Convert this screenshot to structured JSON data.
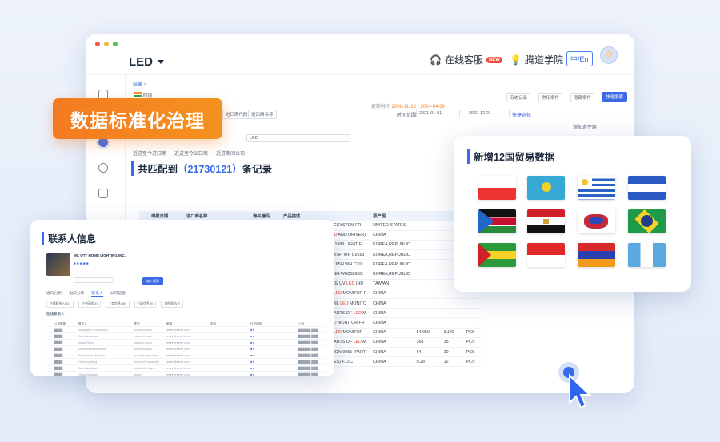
{
  "app": {
    "title": "LED",
    "support": "在线客服",
    "support_badge": "NEW",
    "academy": "腾道学院",
    "lang": "中/En"
  },
  "tabs": {
    "current": "结果",
    "close": "×",
    "country": "印度"
  },
  "filters": {
    "date_label": "时间范围",
    "date_start": "2021-01-01",
    "date_end": "2022-12-21",
    "quick": "快捷选择",
    "update_label": "更新时间",
    "update_from": "2006-11-12",
    "update_to": "2024-04-30",
    "history": "历史记录",
    "common": "常用条件",
    "hide": "隐藏条件",
    "search_btn": "快速搜索",
    "add_cond": "添加条件组",
    "keyword": "LED",
    "import1": "进口商代码",
    "import2": "进口商名称",
    "opt1": "近进至今进口商",
    "opt2": "近进至今出口商",
    "opt3": "近进期间公司"
  },
  "result": {
    "prefix": "共匹配到",
    "count": "（21730121）",
    "suffix": "条记录"
  },
  "table": {
    "headers": [
      "",
      "申报日期",
      "进口商名称",
      "",
      "海关编码",
      "产品描述",
      "原产国",
      "",
      "",
      ""
    ],
    "rows": [
      [
        "2022-12-21",
        "",
        "",
        "85437099",
        "36990754 LED-UV-CURINGSYSTEM FR",
        "UNITED STATES",
        "",
        "",
        ""
      ],
      [
        "2022-12-21",
        "",
        "",
        "94054900",
        "HANGING LIGHT (W/O LED AND DRIVER)",
        "CHINA",
        "",
        "",
        ""
      ],
      [
        "2022-12-21",
        "",
        "",
        "85414090",
        "LED SW-S3752-PW-T (3621989 LIGHT E",
        "KOREA,REPUBLIC",
        "",
        "",
        ""
      ],
      [
        "2022-12-21",
        "",
        "",
        "85414090",
        "LED SH-WHD0204-PL BLUISH WH C9163",
        "KOREA,REPUBLIC",
        "",
        "",
        ""
      ],
      [
        "2022-12-21",
        "",
        "",
        "85414090",
        "LED WS-L3612-BH-HC BLUISH WH C101",
        "KOREA,REPUBLIC",
        "",
        "",
        ""
      ],
      [
        "2022-12-21",
        "",
        "",
        "85414090",
        "LED SH-WH3526B3_WH_SH-WH3526BC",
        "KOREA,REPUBLIC",
        "",
        "",
        ""
      ],
      [
        "2022-12-21",
        "",
        "",
        "85414090",
        "H05WV12A-CSP-HPL MAKE UV LED (HD",
        "TAIWAN",
        "",
        "",
        ""
      ],
      [
        "2022-12-21",
        "",
        "",
        "85299090",
        "MON-0088 30.1CM WIDE LED MONITOR F",
        "CHINA",
        "",
        "",
        ""
      ],
      [
        "2022-12-21",
        "",
        "",
        "85299090",
        "MON-0087 28.1CM SQUARE LED MONITO",
        "CHINA",
        "",
        "",
        ""
      ],
      [
        "2022-12-21",
        "",
        "",
        "85299090",
        "PANEL FOR MON-0056 (PARTS OF LED M",
        "CHINA",
        "",
        "",
        ""
      ],
      [
        "2022-12-21",
        "",
        "",
        "85299090",
        "MON-0056 16.5\" WIDE LED MONITOR FR",
        "CHINA",
        "",
        "",
        ""
      ],
      [
        "2022-12-21",
        "",
        "",
        "85299090",
        "MON-0054 50.8CM WIDE LED MONITOR",
        "CHINA",
        "54,059",
        "3,140",
        "PCS"
      ],
      [
        "2022-12-21",
        "",
        "",
        "85299090",
        "PANEL FOR MON-0054 (PARTS OF LED M",
        "CHINA",
        "368",
        "35",
        "PCS"
      ],
      [
        "2022-12-21",
        "",
        "",
        "85299090",
        "HDMI PCB BOARD FOR MON-0055 (PART",
        "CHINA",
        "64",
        "20",
        "PCS"
      ],
      [
        "2022-12-21",
        "",
        "",
        "85299090",
        "LED FOR MS-0059 (SPARES) F.O.C",
        "CHINA",
        "0.28",
        "12",
        "PCS"
      ],
      [
        "2022-12-21",
        "",
        "",
        "85369090",
        "IP6566 - SWITRATEC SIPPO KEY SWITC",
        "SWITZERLAND",
        "689.78",
        "50",
        "NOS"
      ],
      [
        "2022-12-21",
        "",
        "",
        "85365090",
        "IP6565 - PUSH BUTTON, LED WHITE",
        "SWITZERLAND",
        "2,710.6",
        "150",
        "NOS"
      ],
      [
        "2022-12-21",
        "",
        "",
        "85299090",
        "OPEN CELL (FT43OT01-043) SPARE PA",
        "CHINA",
        "1,624",
        "32",
        "NOS"
      ],
      [
        "2022-12-21",
        "",
        "",
        "85299090",
        "DVR PART-1006172581 -LED_LED,RED,LI",
        "CHINA",
        "164.6",
        "15,000",
        "NOS"
      ],
      [
        "2022-12-21",
        "",
        "",
        "85299090",
        "CCTV CAMERA PART-10600291 -LED -L",
        "CHINA",
        "28.85",
        "4,000",
        "NOS"
      ]
    ]
  },
  "banner": {
    "text": "数据标准化治理"
  },
  "contacts": {
    "title": "联系人信息",
    "company": "MC OTT HOME LIGHTING INC.",
    "tabs": [
      "进口分析",
      "出口分析",
      "联系人",
      "公司信息"
    ],
    "active_tab": "联系人",
    "sub_tabs": [
      "在线联系人(41)",
      "社交网络(3)",
      "工商信息(56)",
      "行政信息(9)",
      "其他网站(7)"
    ],
    "list_label": "在线联系人",
    "col1": "公司职能",
    "col2": "联系人",
    "col3": "职位",
    "col4": "邮箱",
    "col5": "电话",
    "col6": "社交网络",
    "col7": "公司",
    "btn": "加入线索",
    "positions": [
      "Installation Coordinator",
      "Sales Associate",
      "Inside Sales",
      "Sales Representative",
      "Warehouse Manager",
      "Home Lighting",
      "Sales Assistant",
      "Office Manager"
    ],
    "roles": [
      "buyer contact",
      "channel buyer",
      "planner buyer",
      "buyer contact",
      "purchasing contact",
      "buyer of household",
      "distributor buyer",
      "buyer"
    ],
    "emails": [
      "●●●●@●●●●.com",
      "●●●●@●●●●.com",
      "●●●●@●●●●.com",
      "●●●●@●●●●.com",
      "●●●●@●●●●.com",
      "●●●●@●●●●.com",
      "●●●●@●●●●.com",
      "●●●●@●●●●.com"
    ]
  },
  "countries": {
    "title": "新增12国贸易数据"
  }
}
